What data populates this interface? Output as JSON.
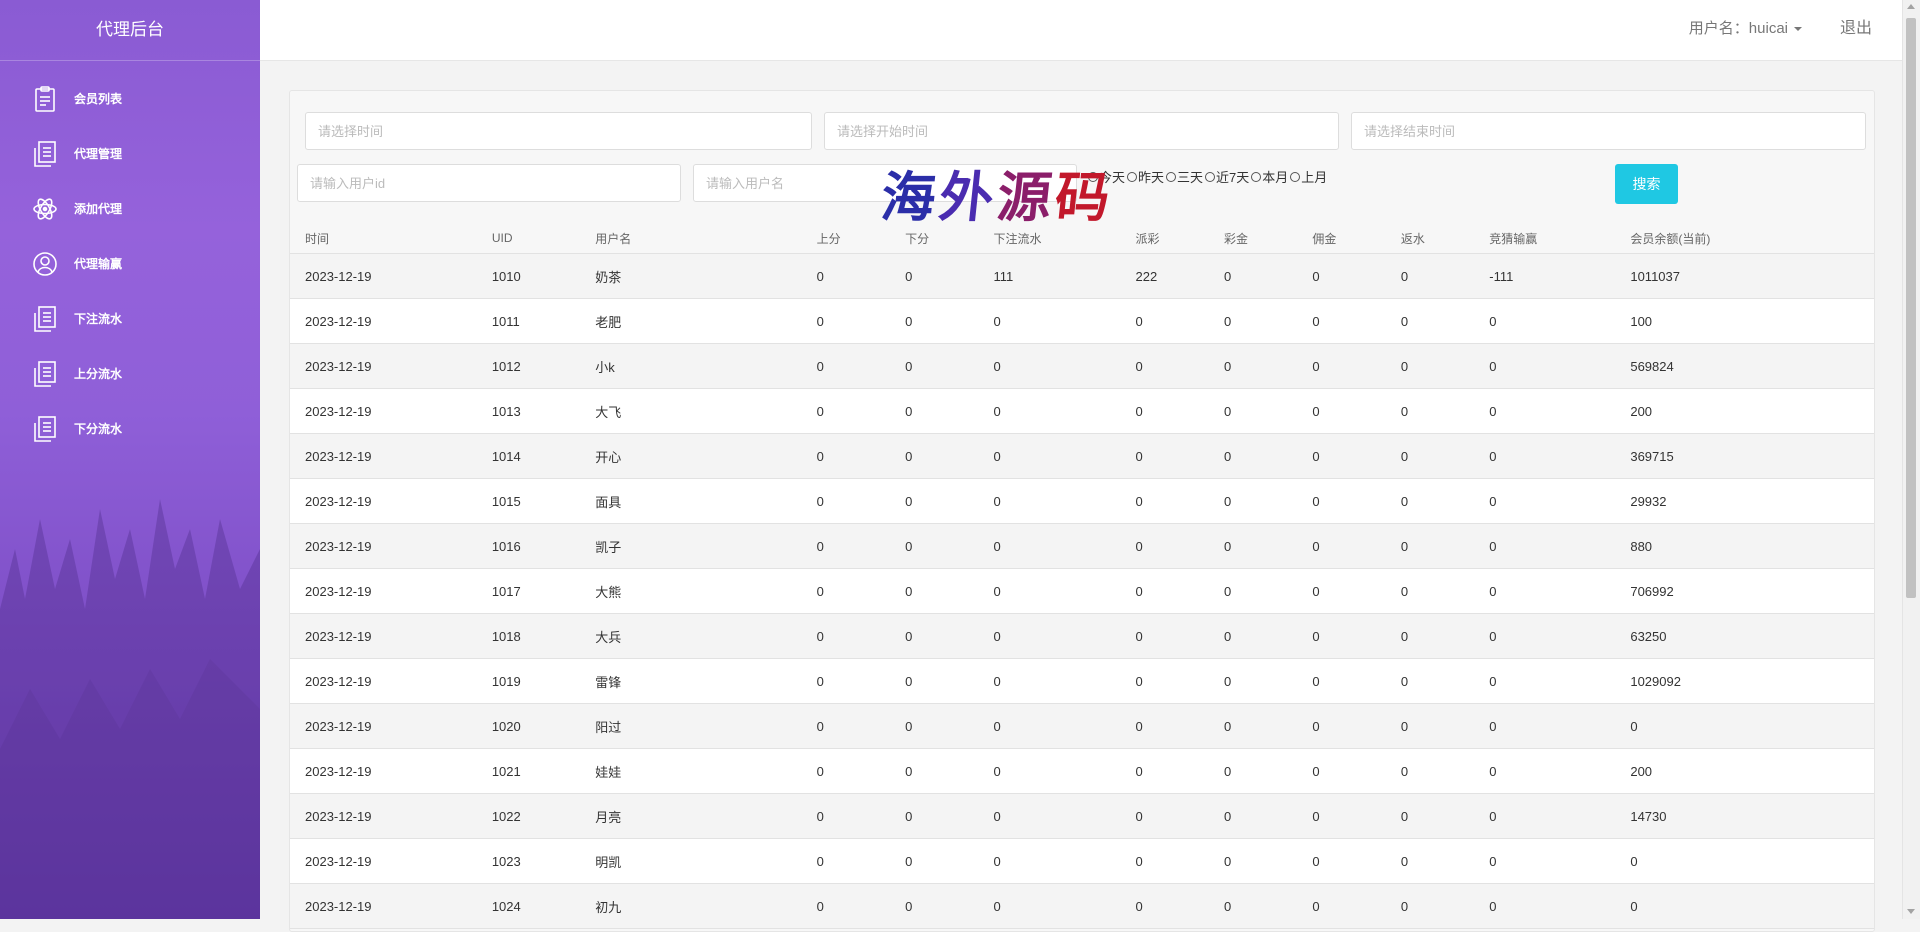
{
  "sidebar": {
    "brand": "代理后台",
    "items": [
      {
        "label": "会员列表",
        "icon": "clipboard-icon"
      },
      {
        "label": "代理管理",
        "icon": "ledger-icon"
      },
      {
        "label": "添加代理",
        "icon": "atom-icon"
      },
      {
        "label": "代理输赢",
        "icon": "user-circle-icon"
      },
      {
        "label": "下注流水",
        "icon": "ledger-icon"
      },
      {
        "label": "上分流水",
        "icon": "ledger-icon"
      },
      {
        "label": "下分流水",
        "icon": "ledger-icon"
      }
    ]
  },
  "topbar": {
    "user_label": "用户名：huicai",
    "logout": "退出"
  },
  "watermark": [
    "海",
    "外",
    "源",
    "码"
  ],
  "filters": {
    "time_placeholder": "请选择时间",
    "start_placeholder": "请选择开始时间",
    "end_placeholder": "请选择结束时间",
    "uid_placeholder": "请输入用户id",
    "username_placeholder": "请输入用户名",
    "ranges": [
      "今天",
      "昨天",
      "三天",
      "近7天",
      "本月",
      "上月"
    ],
    "search_label": "搜索"
  },
  "table": {
    "headers": [
      "时间",
      "UID",
      "用户名",
      "上分",
      "下分",
      "下注流水",
      "派彩",
      "彩金",
      "佣金",
      "返水",
      "竞猜输赢",
      "会员余额(当前)"
    ],
    "rows": [
      [
        "2023-12-19",
        "1010",
        "奶茶",
        "0",
        "0",
        "111",
        "222",
        "0",
        "0",
        "0",
        "-111",
        "1011037"
      ],
      [
        "2023-12-19",
        "1011",
        "老肥",
        "0",
        "0",
        "0",
        "0",
        "0",
        "0",
        "0",
        "0",
        "100"
      ],
      [
        "2023-12-19",
        "1012",
        "小k",
        "0",
        "0",
        "0",
        "0",
        "0",
        "0",
        "0",
        "0",
        "569824"
      ],
      [
        "2023-12-19",
        "1013",
        "大飞",
        "0",
        "0",
        "0",
        "0",
        "0",
        "0",
        "0",
        "0",
        "200"
      ],
      [
        "2023-12-19",
        "1014",
        "开心",
        "0",
        "0",
        "0",
        "0",
        "0",
        "0",
        "0",
        "0",
        "369715"
      ],
      [
        "2023-12-19",
        "1015",
        "面具",
        "0",
        "0",
        "0",
        "0",
        "0",
        "0",
        "0",
        "0",
        "29932"
      ],
      [
        "2023-12-19",
        "1016",
        "凯子",
        "0",
        "0",
        "0",
        "0",
        "0",
        "0",
        "0",
        "0",
        "880"
      ],
      [
        "2023-12-19",
        "1017",
        "大熊",
        "0",
        "0",
        "0",
        "0",
        "0",
        "0",
        "0",
        "0",
        "706992"
      ],
      [
        "2023-12-19",
        "1018",
        "大兵",
        "0",
        "0",
        "0",
        "0",
        "0",
        "0",
        "0",
        "0",
        "63250"
      ],
      [
        "2023-12-19",
        "1019",
        "雷锋",
        "0",
        "0",
        "0",
        "0",
        "0",
        "0",
        "0",
        "0",
        "1029092"
      ],
      [
        "2023-12-19",
        "1020",
        "阳过",
        "0",
        "0",
        "0",
        "0",
        "0",
        "0",
        "0",
        "0",
        "0"
      ],
      [
        "2023-12-19",
        "1021",
        "娃娃",
        "0",
        "0",
        "0",
        "0",
        "0",
        "0",
        "0",
        "0",
        "200"
      ],
      [
        "2023-12-19",
        "1022",
        "月亮",
        "0",
        "0",
        "0",
        "0",
        "0",
        "0",
        "0",
        "0",
        "14730"
      ],
      [
        "2023-12-19",
        "1023",
        "明凯",
        "0",
        "0",
        "0",
        "0",
        "0",
        "0",
        "0",
        "0",
        "0"
      ],
      [
        "2023-12-19",
        "1024",
        "初九",
        "0",
        "0",
        "0",
        "0",
        "0",
        "0",
        "0",
        "0",
        "0"
      ]
    ]
  },
  "colors": {
    "sidebar_top": "#8a5bd3",
    "sidebar_bottom": "#6c3fb6",
    "search_button": "#1fc8e3"
  }
}
